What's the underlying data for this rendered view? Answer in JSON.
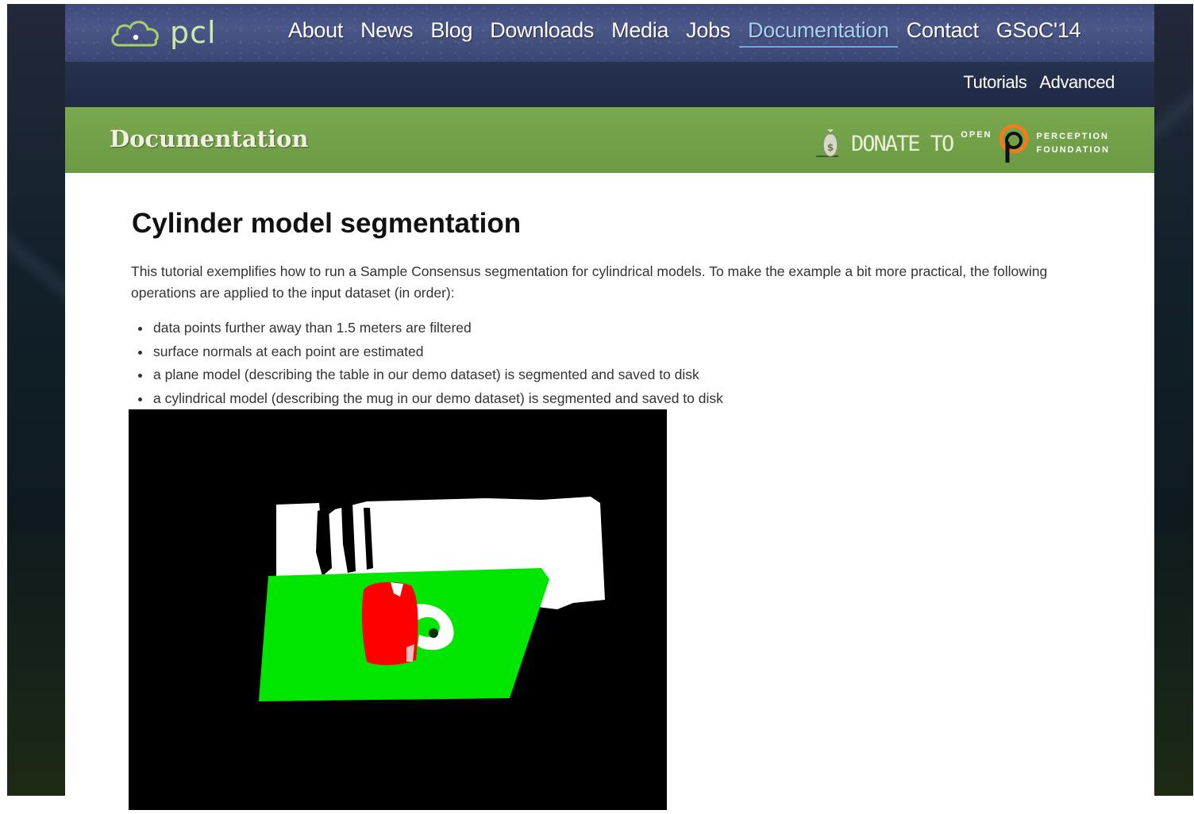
{
  "logo": {
    "text": "pcl",
    "icon": "cloud-icon",
    "color": "#cfe8a8"
  },
  "main_nav": [
    {
      "label": "About",
      "active": false
    },
    {
      "label": "News",
      "active": false
    },
    {
      "label": "Blog",
      "active": false
    },
    {
      "label": "Downloads",
      "active": false
    },
    {
      "label": "Media",
      "active": false
    },
    {
      "label": "Jobs",
      "active": false
    },
    {
      "label": "Documentation",
      "active": true
    },
    {
      "label": "Contact",
      "active": false
    },
    {
      "label": "GSoC'14",
      "active": false
    }
  ],
  "sub_nav": [
    {
      "label": "Tutorials"
    },
    {
      "label": "Advanced"
    }
  ],
  "section": {
    "title": "Documentation"
  },
  "donate": {
    "prefix": "DONATE TO",
    "open": "OPEN",
    "perception": "PERCEPTION",
    "foundation": "FOUNDATION",
    "icon": "money-bag-icon"
  },
  "article": {
    "title": "Cylinder model segmentation",
    "intro": "This tutorial exemplifies how to run a Sample Consensus segmentation for cylindrical models. To make the example a bit more practical, the following operations are applied to the input dataset (in order):",
    "bullets": [
      "data points further away than 1.5 meters are filtered",
      "surface normals at each point are estimated",
      "a plane model (describing the table in our demo dataset) is segmented and saved to disk",
      "a cylindrical model (describing the mug in our demo dataset) is segmented and saved to disk"
    ]
  },
  "colors": {
    "header_bg": "#3d4a7a",
    "green_bar": "#6c9a44",
    "nav_active": "#a9d0f5",
    "segment_plane": "#00e600",
    "segment_cylinder": "#ff0000",
    "background_cloud": "#ffffff"
  }
}
